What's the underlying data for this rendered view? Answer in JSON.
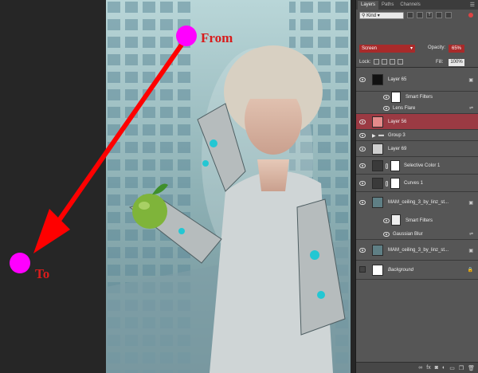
{
  "annotation": {
    "from_label": "From",
    "to_label": "To",
    "colors": {
      "arrow": "#ff0000",
      "dot": "#ff00ff",
      "label": "#d81c1c"
    }
  },
  "panel": {
    "tabs": [
      {
        "label": "Layers",
        "active": true
      },
      {
        "label": "Paths",
        "active": false
      },
      {
        "label": "Channels",
        "active": false
      }
    ],
    "menu_icon": "panel-menu-icon",
    "filter": {
      "kind": "Kind"
    },
    "blend_mode": "Screen",
    "opacity_label": "Opacity:",
    "opacity_value": "65%",
    "lock_label": "Lock:",
    "fill_label": "Fill:",
    "fill_value": "100%",
    "layers": [
      {
        "name": "Layer 65"
      },
      {
        "name": "Smart Filters"
      },
      {
        "name": "Lens Flare"
      },
      {
        "name": "Layer 56",
        "selected": true
      },
      {
        "name": "Group 3"
      },
      {
        "name": "Layer 69"
      },
      {
        "name": "Selective Color 1"
      },
      {
        "name": "Curves 1"
      },
      {
        "name": "MAM_ceiling_3_by_linz_st..."
      },
      {
        "name": "Smart Filters"
      },
      {
        "name": "Gaussian Blur"
      },
      {
        "name": "MAM_ceiling_3_by_linz_st..."
      },
      {
        "name": "Background"
      }
    ],
    "bottom_icons": [
      "link-icon",
      "fx-icon",
      "mask-icon",
      "adjustment-icon",
      "folder-icon",
      "new-layer-icon",
      "trash-icon"
    ]
  }
}
